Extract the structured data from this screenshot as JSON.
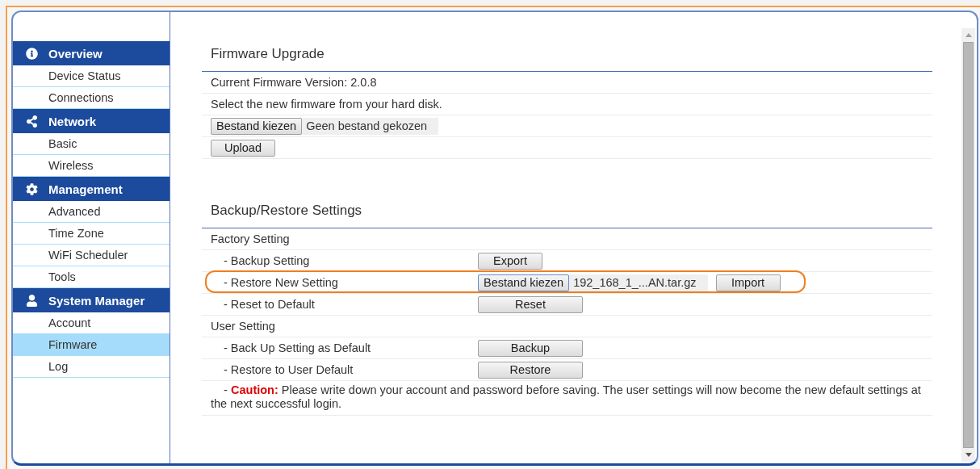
{
  "sidebar": {
    "groups": [
      {
        "title": "Overview",
        "items": [
          {
            "label": "Device Status",
            "selected": false
          },
          {
            "label": "Connections",
            "selected": false
          }
        ]
      },
      {
        "title": "Network",
        "items": [
          {
            "label": "Basic",
            "selected": false
          },
          {
            "label": "Wireless",
            "selected": false
          }
        ]
      },
      {
        "title": "Management",
        "items": [
          {
            "label": "Advanced",
            "selected": false
          },
          {
            "label": "Time Zone",
            "selected": false
          },
          {
            "label": "WiFi Scheduler",
            "selected": false
          },
          {
            "label": "Tools",
            "selected": false
          }
        ]
      },
      {
        "title": "System Manager",
        "items": [
          {
            "label": "Account",
            "selected": false
          },
          {
            "label": "Firmware",
            "selected": true
          },
          {
            "label": "Log",
            "selected": false
          }
        ]
      }
    ]
  },
  "sections": [
    {
      "title": "Firmware Upgrade",
      "rows": [
        {
          "kind": "text",
          "text": "Current Firmware Version: 2.0.8"
        },
        {
          "kind": "text",
          "text": "Select the new firmware from your hard disk."
        },
        {
          "kind": "controls",
          "controls": [
            {
              "kind": "file",
              "button": "Bestand kiezen",
              "filename": "Geen bestand gekozen",
              "focused": false
            }
          ]
        },
        {
          "kind": "controls",
          "controls": [
            {
              "kind": "button",
              "label": "Upload"
            }
          ]
        }
      ]
    },
    {
      "title": "Backup/Restore Settings",
      "rows": [
        {
          "kind": "text",
          "text": "Factory Setting"
        },
        {
          "kind": "setting",
          "label": "- Backup Setting",
          "highlighted": false,
          "controls": [
            {
              "kind": "button",
              "label": "Export"
            }
          ]
        },
        {
          "kind": "setting",
          "label": "- Restore New Setting",
          "highlighted": true,
          "controls": [
            {
              "kind": "file",
              "button": "Bestand kiezen",
              "filename": "192_168_1_...AN.tar.gz",
              "focused": true
            },
            {
              "kind": "button",
              "label": "Import"
            }
          ]
        },
        {
          "kind": "setting",
          "label": "- Reset to Default",
          "highlighted": false,
          "controls": [
            {
              "kind": "wide_button",
              "label": "Reset"
            }
          ]
        },
        {
          "kind": "text",
          "text": "User Setting"
        },
        {
          "kind": "setting",
          "label": "- Back Up Setting as Default",
          "highlighted": false,
          "controls": [
            {
              "kind": "wide_button",
              "label": "Backup"
            }
          ]
        },
        {
          "kind": "setting",
          "label": "- Restore to User Default",
          "highlighted": false,
          "controls": [
            {
              "kind": "wide_button",
              "label": "Restore"
            }
          ]
        },
        {
          "kind": "note",
          "prefix": "- ",
          "warning": "Caution:",
          "text": "Please write down your account and password before saving. The user settings will now become the new default settings at the next successful login."
        }
      ]
    }
  ]
}
